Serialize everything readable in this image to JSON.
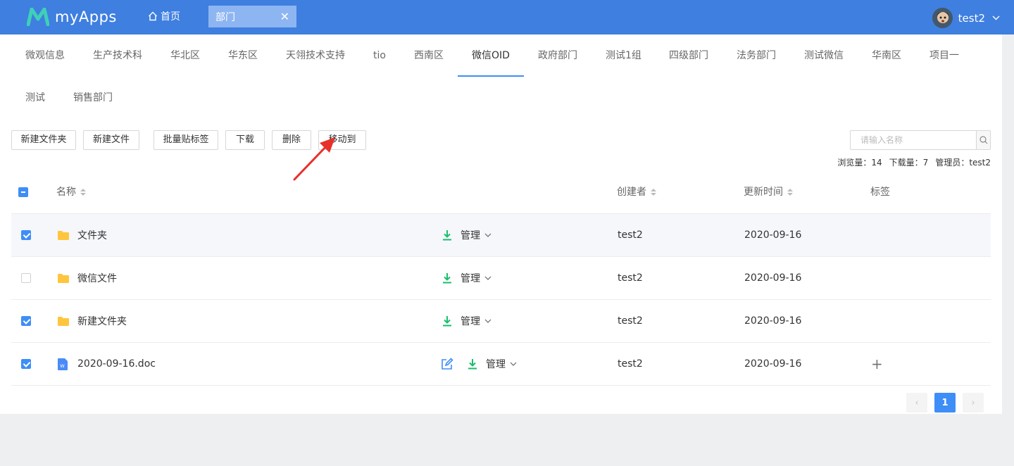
{
  "app": {
    "name": "myApps",
    "brand_color": "#3e7fe0"
  },
  "topbar": {
    "home_label": "首页",
    "open_tab": {
      "label": "部门",
      "close": "✕"
    },
    "user": {
      "name": "test2"
    }
  },
  "dept_tabs": [
    {
      "label": "微观信息",
      "active": false
    },
    {
      "label": "生产技术科",
      "active": false
    },
    {
      "label": "华北区",
      "active": false
    },
    {
      "label": "华东区",
      "active": false
    },
    {
      "label": "天翎技术支持",
      "active": false
    },
    {
      "label": "tio",
      "active": false
    },
    {
      "label": "西南区",
      "active": false
    },
    {
      "label": "微信OID",
      "active": true
    },
    {
      "label": "政府部门",
      "active": false
    },
    {
      "label": "测试1组",
      "active": false
    },
    {
      "label": "四级部门",
      "active": false
    },
    {
      "label": "法务部门",
      "active": false
    },
    {
      "label": "测试微信",
      "active": false
    },
    {
      "label": "华南区",
      "active": false
    },
    {
      "label": "项目一",
      "active": false
    },
    {
      "label": "测试",
      "active": false
    },
    {
      "label": "销售部门",
      "active": false
    }
  ],
  "toolbar": {
    "new_folder": "新建文件夹",
    "new_file": "新建文件",
    "batch_tag": "批量贴标签",
    "download": "下载",
    "delete": "删除",
    "move_to": "移动到"
  },
  "search": {
    "placeholder": "请输入名称",
    "icon": "search-icon"
  },
  "stats": {
    "views": "浏览量：14",
    "downloads": "下载量：7",
    "admin": "管理员：test2"
  },
  "table": {
    "headers": {
      "name": "名称",
      "creator": "创建者",
      "updated": "更新时间",
      "tags": "标签"
    },
    "manage_label": "管理",
    "rows": [
      {
        "name": "文件夹",
        "type": "folder",
        "checked": true,
        "highlight": true,
        "creator": "test2",
        "updated": "2020-09-16"
      },
      {
        "name": "微信文件",
        "type": "folder",
        "checked": false,
        "highlight": false,
        "creator": "test2",
        "updated": "2020-09-16"
      },
      {
        "name": "新建文件夹",
        "type": "folder",
        "checked": true,
        "highlight": false,
        "creator": "test2",
        "updated": "2020-09-16"
      },
      {
        "name": "2020-09-16.doc",
        "type": "doc",
        "checked": true,
        "highlight": false,
        "creator": "test2",
        "updated": "2020-09-16",
        "tag_add": "+"
      }
    ]
  },
  "pagination": {
    "prev": "‹",
    "current": "1",
    "next": "›"
  },
  "colors": {
    "accent": "#3e8ef7",
    "download_green": "#19be6b",
    "folder_yellow": "#ffc53d",
    "annotation_red": "#e8302a"
  }
}
